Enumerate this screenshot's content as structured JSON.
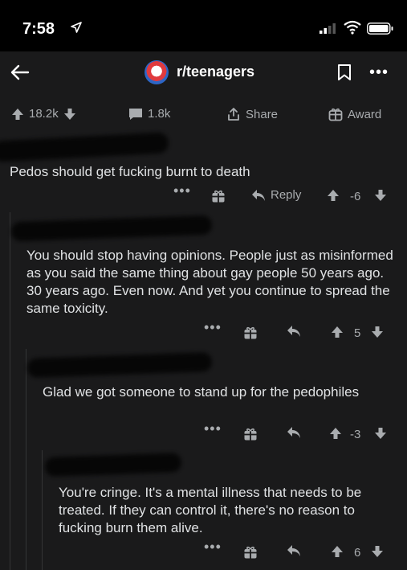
{
  "status_bar": {
    "time": "7:58"
  },
  "header": {
    "subreddit": "r/teenagers"
  },
  "post_actions": {
    "upvotes": "18.2k",
    "comments": "1.8k",
    "share": "Share",
    "award": "Award"
  },
  "comments": [
    {
      "text": "Pedos should get fucking burnt to death",
      "reply": "Reply",
      "score": "-6"
    },
    {
      "text": "You should stop having opinions. People just as misinformed as you said the same thing about gay people 50 years ago. 30 years ago. Even now. And yet you continue to spread the same toxicity.",
      "score": "5"
    },
    {
      "text": "Glad we got someone to stand up for the pedophiles",
      "score": "-3"
    },
    {
      "text": "You're cringe. It's a mental illness that needs to be treated. If they can control it, there's no reason to fucking burn them alive.",
      "score": "6"
    }
  ],
  "colors": {
    "background": "#1a1a1b",
    "text": "#d7dadc",
    "muted": "#a9acaf"
  }
}
